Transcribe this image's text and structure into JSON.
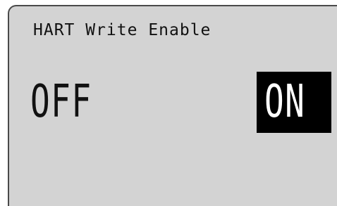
{
  "screen": {
    "title": "HART Write Enable",
    "options": [
      {
        "label": "OFF",
        "selected": false
      },
      {
        "label": "ON",
        "selected": true
      }
    ]
  }
}
